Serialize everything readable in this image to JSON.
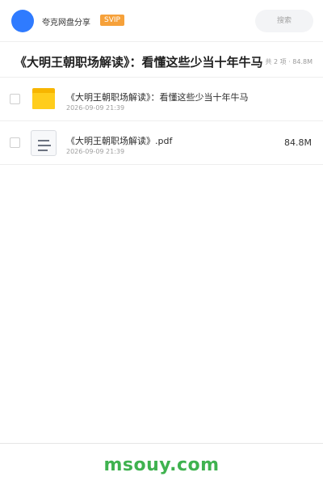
{
  "header": {
    "brand": "夸克网盘分享",
    "badge": "SVIP",
    "search_placeholder": "搜索"
  },
  "folder": {
    "title": "《大明王朝职场解读》：看懂这些少当十年牛马",
    "meta": "共 2 项 · 84.8M"
  },
  "files": [
    {
      "name": "《大明王朝职场解读》：看懂这些少当十年牛马",
      "time": "2026-09-09 21:39",
      "size": "",
      "icon": "folder-icon"
    },
    {
      "name": "《大明王朝职场解读》.pdf",
      "time": "2026-09-09 21:39",
      "size": "84.8M",
      "icon": "document-icon"
    }
  ],
  "footer": {
    "watermark": "msouy.com"
  },
  "colors": {
    "avatar": "#2f7bff",
    "badge": "#f6a13a",
    "folder": "#ffcd1c",
    "watermark": "#3fb24f"
  }
}
